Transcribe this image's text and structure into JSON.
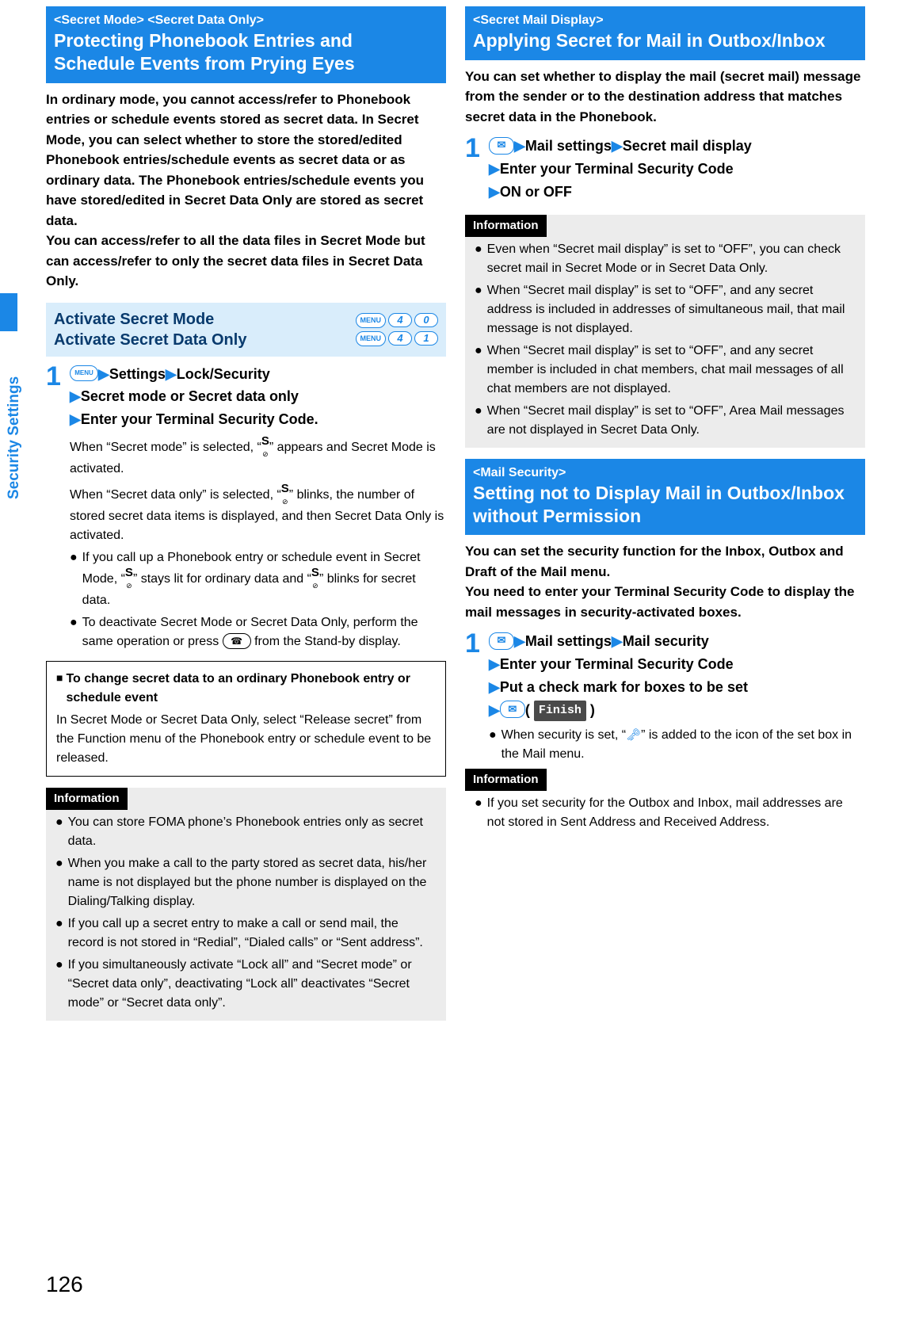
{
  "sideTab": "Security Settings",
  "pageNumber": "126",
  "left": {
    "tag": "<Secret Mode> <Secret Data Only>",
    "title": "Protecting Phonebook Entries and Schedule Events from Prying Eyes",
    "intro": "In ordinary mode, you cannot access/refer to Phonebook entries or schedule events stored as secret data. In Secret Mode, you can select whether to store the stored/edited Phonebook entries/schedule events as secret data or as ordinary data. The Phonebook entries/schedule events you have stored/edited in Secret Data Only are stored as secret data.\nYou can access/refer to all the data files in Secret Mode but can access/refer to only the secret data files in Secret Data Only.",
    "subhead1": "Activate Secret Mode\nActivate Secret Data Only",
    "menuLabel": "MENU",
    "k1a": "4",
    "k1b": "0",
    "k2a": "4",
    "k2b": "1",
    "step1num": "1",
    "nav1a": "Settings",
    "nav1b": "Lock/Security",
    "nav1c": "Secret mode or Secret data only",
    "nav1d": "Enter your Terminal Security Code.",
    "desc1a": "When “Secret mode” is selected, “",
    "desc1b": "” appears and Secret Mode is activated.",
    "desc2a": "When “Secret data only” is selected, “",
    "desc2b": "” blinks, the number of stored secret data items is displayed, and then Secret Data Only is activated.",
    "bul1a": "If you call up a Phonebook entry or schedule event in Secret Mode, “",
    "bul1b": "” stays lit for ordinary data and “",
    "bul1c": "” blinks for secret data.",
    "bul2a": "To deactivate Secret Mode or Secret Data Only, perform the same operation or press ",
    "bul2b": " from the Stand-by display.",
    "noteHead": "To change secret data to an ordinary Phonebook entry or schedule event",
    "noteBody": "In Secret Mode or Secret Data Only, select “Release secret” from the Function menu of the Phonebook entry or schedule event to be released.",
    "infoLabel": "Information",
    "info1": "You can store FOMA phone’s Phonebook entries only as secret data.",
    "info2": "When you make a call to the party stored as secret data, his/her name is not displayed but the phone number is displayed on the Dialing/Talking display.",
    "info3": "If you call up a secret entry to make a call or send mail, the record is not stored in “Redial”, “Dialed calls” or “Sent address”.",
    "info4": "If you simultaneously activate “Lock all” and “Secret mode” or “Secret data only”, deactivating “Lock all” deactivates “Secret mode” or “Secret data only”."
  },
  "right": {
    "tag1": "<Secret Mail Display>",
    "title1": "Applying Secret for Mail in Outbox/Inbox",
    "intro1": "You can set whether to display the mail (secret mail) message from the sender or to the destination address that matches secret data in the Phonebook.",
    "r1num": "1",
    "r1a": "Mail settings",
    "r1b": "Secret mail display",
    "r1c": "Enter your Terminal Security Code",
    "r1d": "ON or OFF",
    "infoLabel": "Information",
    "ri1": "Even when “Secret mail display” is set to “OFF”, you can check secret mail in Secret Mode or in Secret Data Only.",
    "ri2": "When “Secret mail display” is set to “OFF”, and any secret address is included in addresses of simultaneous mail, that mail message is not displayed.",
    "ri3": "When “Secret mail display” is set to “OFF”, and any secret member is included in chat members, chat mail messages of all chat members are not displayed.",
    "ri4": "When “Secret mail display” is set to “OFF”, Area Mail messages are not displayed in Secret Data Only.",
    "tag2": "<Mail Security>",
    "title2": "Setting not to Display Mail in Outbox/Inbox without Permission",
    "intro2": "You can set the security function for the Inbox, Outbox and Draft of the Mail menu.\nYou need to enter your Terminal Security Code to display the mail messages in security-activated boxes.",
    "r2num": "1",
    "r2a": "Mail settings",
    "r2b": "Mail security",
    "r2c": "Enter your Terminal Security Code",
    "r2d": "Put a check mark for boxes to be set",
    "finish": "Finish",
    "r2bul_a": "When security is set, “",
    "r2bul_b": "” is added to the icon of the set box in the Mail menu.",
    "ri5": "If you set security for the Outbox and Inbox, mail addresses are not stored in Sent Address and Received Address."
  }
}
